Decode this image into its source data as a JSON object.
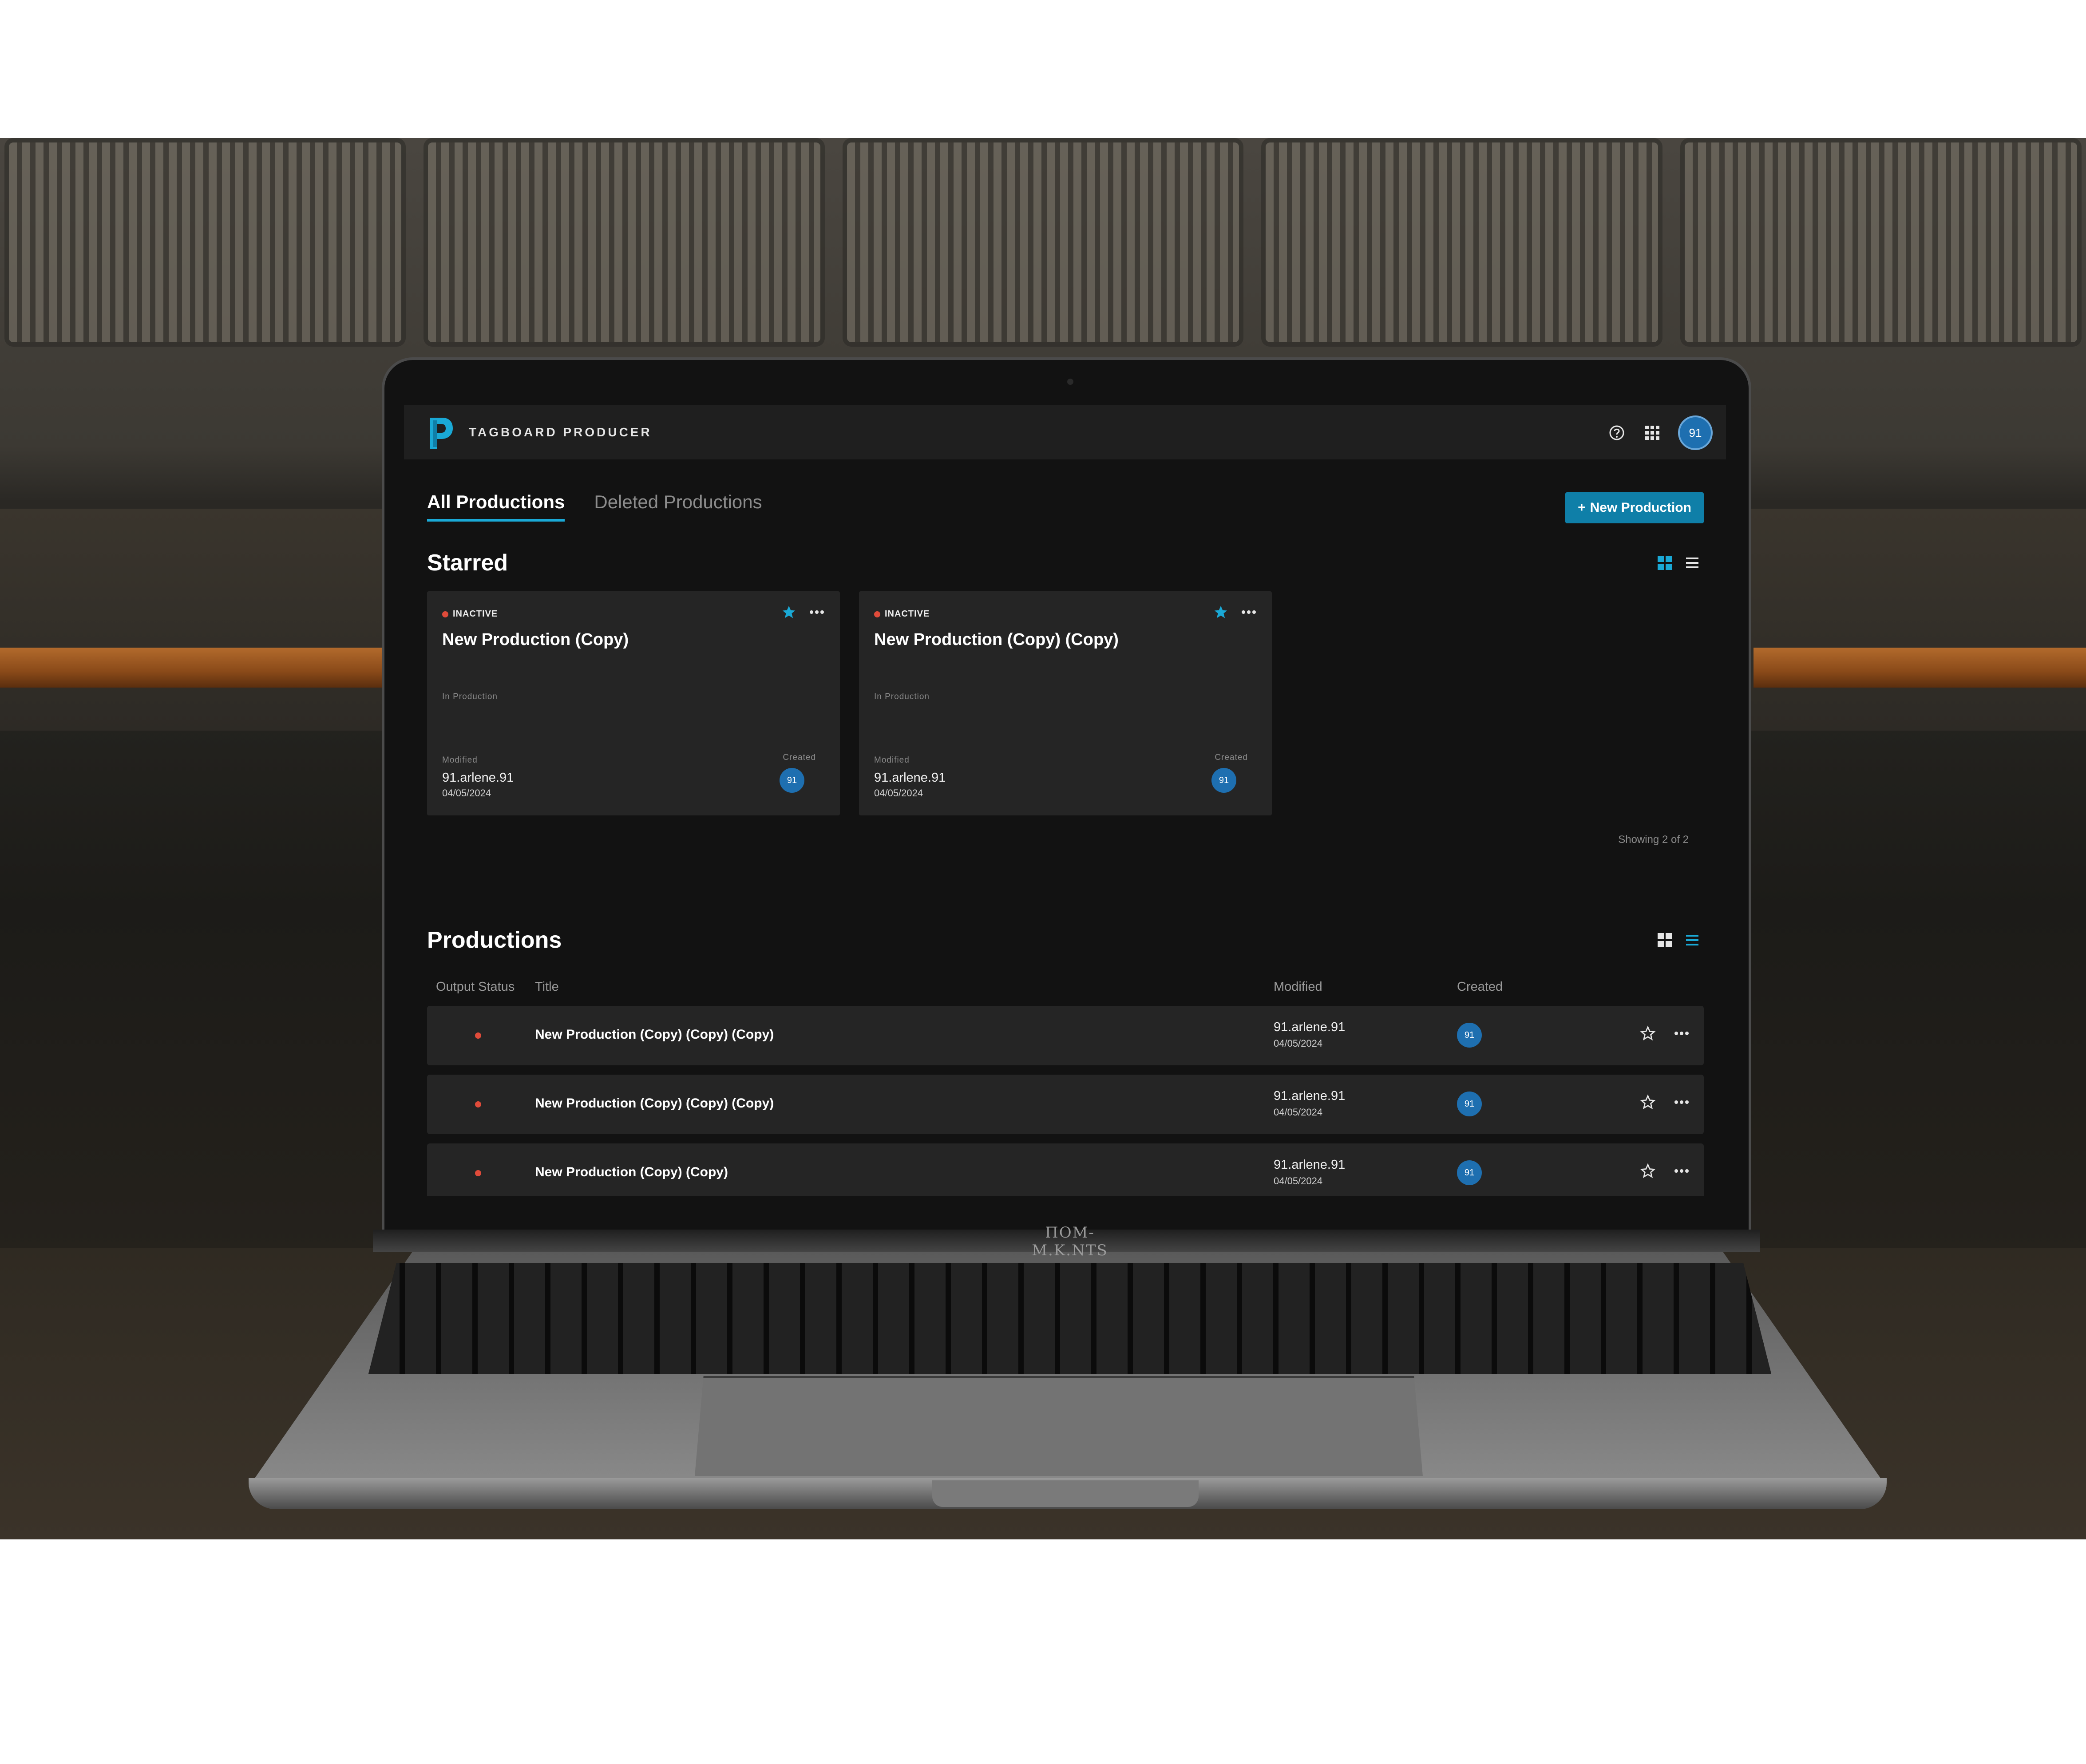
{
  "device": {
    "brand_text": "ΠOM-M.K.NTS"
  },
  "app": {
    "title": "TAGBOARD PRODUCER",
    "user_initials": "91"
  },
  "tabs": [
    {
      "label": "All Productions",
      "active": true
    },
    {
      "label": "Deleted Productions",
      "active": false
    }
  ],
  "new_button": {
    "icon": "+",
    "label": "New Production"
  },
  "starred": {
    "title": "Starred",
    "view": "grid",
    "cards": [
      {
        "status": "INACTIVE",
        "title": "New Production (Copy)",
        "stage": "In Production",
        "modified_label": "Modified",
        "modified_by": "91.arlene.91",
        "modified_date": "04/05/2024",
        "created_label": "Created",
        "created_by_initials": "91",
        "starred": true
      },
      {
        "status": "INACTIVE",
        "title": "New Production (Copy) (Copy)",
        "stage": "In Production",
        "modified_label": "Modified",
        "modified_by": "91.arlene.91",
        "modified_date": "04/05/2024",
        "created_label": "Created",
        "created_by_initials": "91",
        "starred": true
      }
    ],
    "showing": "Showing 2 of 2"
  },
  "productions": {
    "title": "Productions",
    "view": "list",
    "columns": {
      "status": "Output Status",
      "title": "Title",
      "modified": "Modified",
      "created": "Created"
    },
    "rows": [
      {
        "title": "New Production (Copy) (Copy) (Copy)",
        "modified_by": "91.arlene.91",
        "modified_date": "04/05/2024",
        "created_by_initials": "91"
      },
      {
        "title": "New Production (Copy) (Copy) (Copy)",
        "modified_by": "91.arlene.91",
        "modified_date": "04/05/2024",
        "created_by_initials": "91"
      },
      {
        "title": "New Production (Copy) (Copy)",
        "modified_by": "91.arlene.91",
        "modified_date": "04/05/2024",
        "created_by_initials": "91"
      }
    ]
  },
  "colors": {
    "accent": "#1aa9d6",
    "primary_button": "#0f7fa8",
    "inactive": "#e04b3a",
    "avatar": "#1e6fb0"
  },
  "icons": [
    "logo-icon",
    "help-icon",
    "apps-grid-icon",
    "star-icon",
    "more-icon",
    "grid-view-icon",
    "list-view-icon"
  ]
}
